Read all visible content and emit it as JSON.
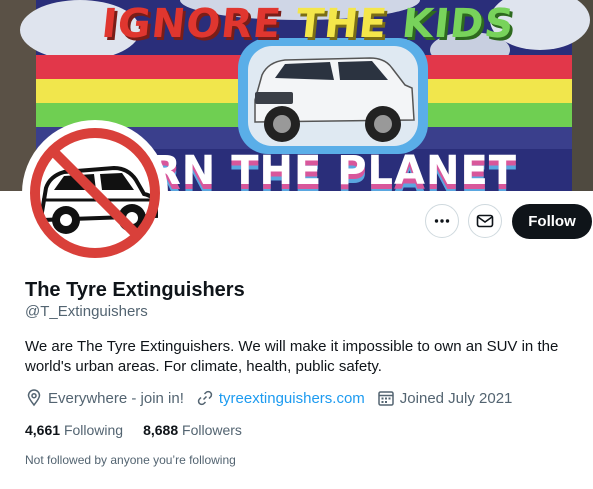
{
  "banner": {
    "headline_words": [
      "IGNORE",
      "THE",
      "KIDS"
    ],
    "bottom_text": "RN THE PLANET"
  },
  "actions": {
    "more_icon": "more-horizontal-icon",
    "message_icon": "envelope-icon",
    "follow_label": "Follow"
  },
  "profile": {
    "name": "The Tyre Extinguishers",
    "handle": "@T_Extinguishers",
    "bio": "We are The Tyre Extinguishers. We will make it impossible to own an SUV in the world's urban areas. For climate, health, public safety.",
    "location": "Everywhere - join in!",
    "website": "tyreextinguishers.com",
    "joined": "Joined July 2021",
    "following_count": "4,661",
    "following_label": "Following",
    "followers_count": "8,688",
    "followers_label": "Followers",
    "followed_by": "Not followed by anyone you’re following"
  },
  "colors": {
    "follow_bg": "#0f1419",
    "link": "#1d9bf0",
    "secondary_text": "#536471",
    "no_symbol_red": "#d9403a"
  }
}
